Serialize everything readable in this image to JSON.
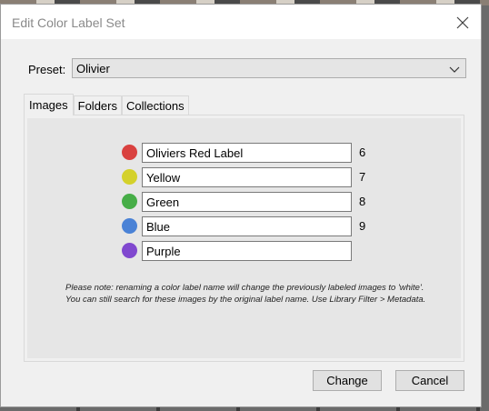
{
  "dialog": {
    "title": "Edit Color Label Set"
  },
  "preset": {
    "label": "Preset:",
    "value": "Olivier"
  },
  "tabs": [
    {
      "label": "Images",
      "active": true
    },
    {
      "label": "Folders",
      "active": false
    },
    {
      "label": "Collections",
      "active": false
    }
  ],
  "labels": [
    {
      "color": "#d9413f",
      "name": "Oliviers Red Label",
      "shortcut": "6"
    },
    {
      "color": "#d4d12b",
      "name": "Yellow",
      "shortcut": "7"
    },
    {
      "color": "#46ad47",
      "name": "Green",
      "shortcut": "8"
    },
    {
      "color": "#4a82d6",
      "name": "Blue",
      "shortcut": "9"
    },
    {
      "color": "#8048cf",
      "name": "Purple",
      "shortcut": ""
    }
  ],
  "note": "Please note: renaming a color label name will change the previously labeled images to 'white'. You can still search for these images by the original label name. Use Library Filter > Metadata.",
  "buttons": {
    "change": "Change",
    "cancel": "Cancel"
  }
}
